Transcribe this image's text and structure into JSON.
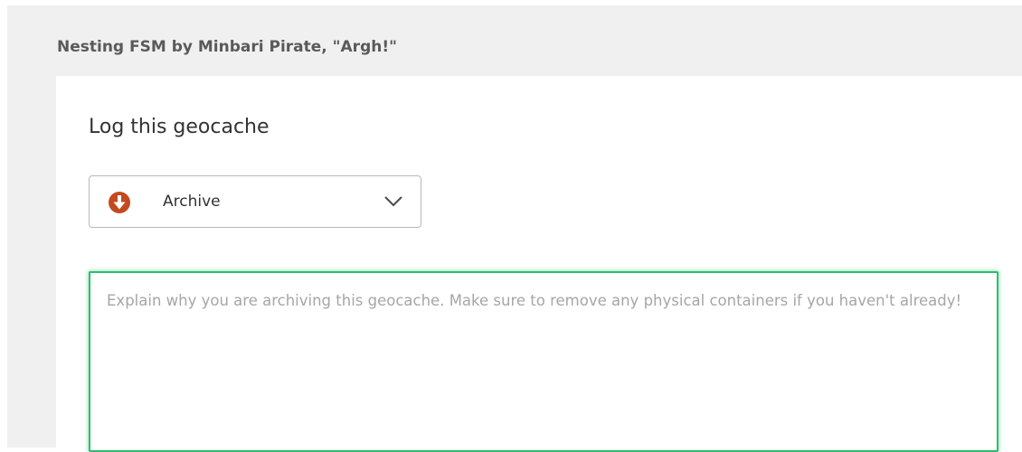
{
  "cache": {
    "title": "Nesting FSM by Minbari Pirate, \"Argh!\""
  },
  "log_form": {
    "heading": "Log this geocache",
    "log_type": {
      "selected": "Archive",
      "icon": "archive-down-arrow-icon",
      "icon_color": "#c4491f"
    },
    "log_text": {
      "value": "",
      "placeholder": "Explain why you are archiving this geocache. Make sure to remove any physical containers if you haven't already!",
      "focus_border_color": "#2ebd6b"
    }
  }
}
